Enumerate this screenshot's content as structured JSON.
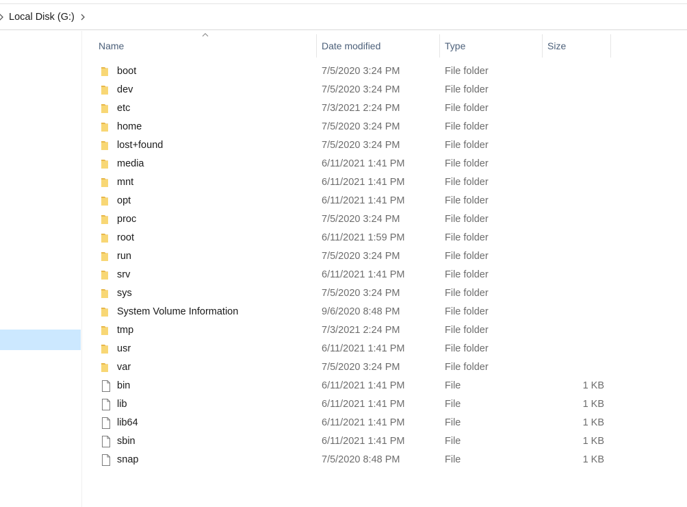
{
  "address": {
    "location": "Local Disk (G:)",
    "back_icon": "chevron-left-icon",
    "separator_icon": "chevron-right-icon"
  },
  "columns": {
    "name": "Name",
    "date": "Date modified",
    "type": "Type",
    "size": "Size",
    "sort_icon": "sort-ascending-icon"
  },
  "items": [
    {
      "name": "boot",
      "date": "7/5/2020 3:24 PM",
      "type": "File folder",
      "size": "",
      "icon": "folder-icon"
    },
    {
      "name": "dev",
      "date": "7/5/2020 3:24 PM",
      "type": "File folder",
      "size": "",
      "icon": "folder-icon"
    },
    {
      "name": "etc",
      "date": "7/3/2021 2:24 PM",
      "type": "File folder",
      "size": "",
      "icon": "folder-icon"
    },
    {
      "name": "home",
      "date": "7/5/2020 3:24 PM",
      "type": "File folder",
      "size": "",
      "icon": "folder-icon"
    },
    {
      "name": "lost+found",
      "date": "7/5/2020 3:24 PM",
      "type": "File folder",
      "size": "",
      "icon": "folder-icon"
    },
    {
      "name": "media",
      "date": "6/11/2021 1:41 PM",
      "type": "File folder",
      "size": "",
      "icon": "folder-icon"
    },
    {
      "name": "mnt",
      "date": "6/11/2021 1:41 PM",
      "type": "File folder",
      "size": "",
      "icon": "folder-icon"
    },
    {
      "name": "opt",
      "date": "6/11/2021 1:41 PM",
      "type": "File folder",
      "size": "",
      "icon": "folder-icon"
    },
    {
      "name": "proc",
      "date": "7/5/2020 3:24 PM",
      "type": "File folder",
      "size": "",
      "icon": "folder-icon"
    },
    {
      "name": "root",
      "date": "6/11/2021 1:59 PM",
      "type": "File folder",
      "size": "",
      "icon": "folder-icon"
    },
    {
      "name": "run",
      "date": "7/5/2020 3:24 PM",
      "type": "File folder",
      "size": "",
      "icon": "folder-icon"
    },
    {
      "name": "srv",
      "date": "6/11/2021 1:41 PM",
      "type": "File folder",
      "size": "",
      "icon": "folder-icon"
    },
    {
      "name": "sys",
      "date": "7/5/2020 3:24 PM",
      "type": "File folder",
      "size": "",
      "icon": "folder-icon"
    },
    {
      "name": "System Volume Information",
      "date": "9/6/2020 8:48 PM",
      "type": "File folder",
      "size": "",
      "icon": "folder-icon"
    },
    {
      "name": "tmp",
      "date": "7/3/2021 2:24 PM",
      "type": "File folder",
      "size": "",
      "icon": "folder-icon"
    },
    {
      "name": "usr",
      "date": "6/11/2021 1:41 PM",
      "type": "File folder",
      "size": "",
      "icon": "folder-icon"
    },
    {
      "name": "var",
      "date": "7/5/2020 3:24 PM",
      "type": "File folder",
      "size": "",
      "icon": "folder-icon"
    },
    {
      "name": "bin",
      "date": "6/11/2021 1:41 PM",
      "type": "File",
      "size": "1 KB",
      "icon": "file-icon"
    },
    {
      "name": "lib",
      "date": "6/11/2021 1:41 PM",
      "type": "File",
      "size": "1 KB",
      "icon": "file-icon"
    },
    {
      "name": "lib64",
      "date": "6/11/2021 1:41 PM",
      "type": "File",
      "size": "1 KB",
      "icon": "file-icon"
    },
    {
      "name": "sbin",
      "date": "6/11/2021 1:41 PM",
      "type": "File",
      "size": "1 KB",
      "icon": "file-icon"
    },
    {
      "name": "snap",
      "date": "7/5/2020 8:48 PM",
      "type": "File",
      "size": "1 KB",
      "icon": "file-icon"
    }
  ],
  "colors": {
    "folder": "#f8d775",
    "folder_dark": "#e8b84a",
    "selection": "#cce8ff",
    "header_text": "#4c607a"
  }
}
